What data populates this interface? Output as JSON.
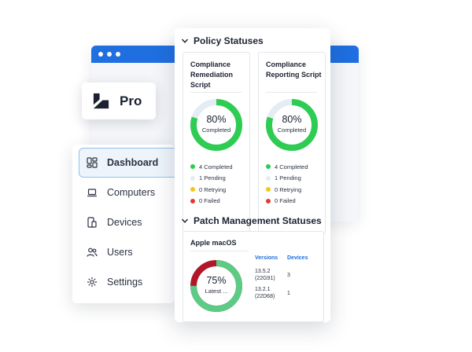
{
  "brand": {
    "product": "Pro"
  },
  "window": {
    "accent": "#1f6fe0"
  },
  "sidebar": {
    "items": [
      {
        "label": "Dashboard",
        "icon": "dashboard-icon",
        "active": true
      },
      {
        "label": "Computers",
        "icon": "laptop-icon"
      },
      {
        "label": "Devices",
        "icon": "devices-icon"
      },
      {
        "label": "Users",
        "icon": "users-icon"
      },
      {
        "label": "Settings",
        "icon": "gear-icon"
      }
    ]
  },
  "policy": {
    "title": "Policy Statuses",
    "cards": [
      {
        "title": "Compliance Remediation Script",
        "percent": 80,
        "percent_label": "80%",
        "status": "Completed",
        "legend": [
          "4 Completed",
          "1 Pending",
          "0 Retrying",
          "0 Failed"
        ]
      },
      {
        "title": "Compliance Reporting Script",
        "percent": 80,
        "percent_label": "80%",
        "status": "Completed",
        "legend": [
          "4 Completed",
          "1 Pending",
          "0 Retrying",
          "0 Failed"
        ]
      }
    ]
  },
  "patch": {
    "title": "Patch Management Statuses",
    "card": {
      "title": "Apple macOS",
      "percent": 75,
      "percent_label": "75%",
      "status": "Latest ...",
      "col_versions": "Versions",
      "col_devices": "Devices",
      "rows": [
        {
          "version": "13.5.2",
          "build": "(22G91)",
          "devices": "3"
        },
        {
          "version": "13.2.1",
          "build": "(22D68)",
          "devices": "1"
        }
      ]
    }
  },
  "colors": {
    "completed": "#2ecc52",
    "pending": "#e4ecf4",
    "retrying": "#f5c518",
    "failed": "#e53935",
    "patch_latest": "#5ccb86",
    "patch_other": "#b0182a"
  }
}
